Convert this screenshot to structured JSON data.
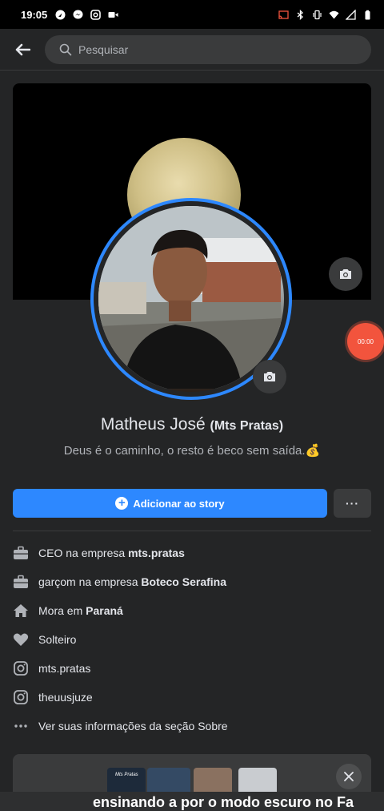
{
  "status_bar": {
    "time": "19:05",
    "left_icons": [
      "navigation-icon",
      "messenger-icon",
      "instagram-icon",
      "video-icon"
    ],
    "right_icons": [
      "cast-icon",
      "bluetooth-icon",
      "vibrate-icon",
      "wifi-icon",
      "signal-icon",
      "battery-icon"
    ]
  },
  "header": {
    "back_icon": "arrow-left-icon",
    "search_placeholder": "Pesquisar"
  },
  "profile": {
    "name": "Matheus José",
    "alternate_name": "(Mts Pratas)",
    "bio": "Deus é o caminho, o resto é beco sem saída.💰"
  },
  "recording": {
    "timer": "00:00"
  },
  "actions": {
    "add_story_label": "Adicionar ao story",
    "more_label": "···"
  },
  "details": [
    {
      "icon": "briefcase-icon",
      "prefix": "CEO na empresa ",
      "bold": "mts.pratas"
    },
    {
      "icon": "briefcase-icon",
      "prefix": "garçom na empresa ",
      "bold": "Boteco Serafina"
    },
    {
      "icon": "home-icon",
      "prefix": "Mora em ",
      "bold": "Paraná"
    },
    {
      "icon": "heart-icon",
      "prefix": "Solteiro",
      "bold": ""
    },
    {
      "icon": "instagram-icon",
      "prefix": "mts.pratas",
      "bold": ""
    },
    {
      "icon": "instagram-icon",
      "prefix": "theuusjuze",
      "bold": ""
    },
    {
      "icon": "more-dots-icon",
      "prefix": "Ver suas informações da seção Sobre",
      "bold": ""
    }
  ],
  "featured_card": {
    "thumb_label": "Mts Pratas"
  },
  "caption": {
    "text": "ensinando a por o modo escuro no Fa"
  },
  "colors": {
    "accent": "#2d88ff",
    "background": "#242526",
    "surface": "#3a3b3c",
    "record": "#f2543d"
  }
}
